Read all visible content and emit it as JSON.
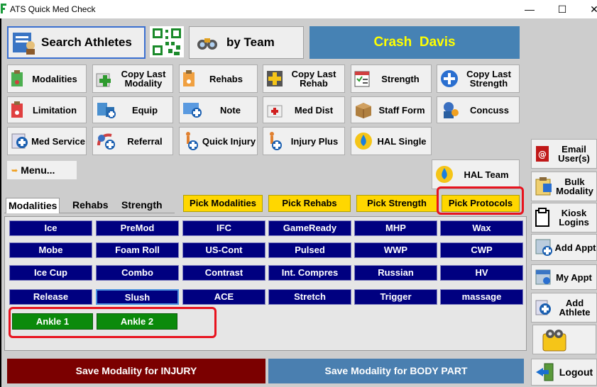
{
  "window": {
    "title": "ATS Quick Med Check",
    "minimize": "—",
    "maximize": "☐",
    "close": "✕"
  },
  "header": {
    "search_athletes": "Search Athletes",
    "by_team": "by Team",
    "athlete_name": "Crash  Davis"
  },
  "quick_buttons": {
    "modalities": "Modalities",
    "copy_last_modality": "Copy Last Modality",
    "rehabs": "Rehabs",
    "copy_last_rehab": "Copy Last Rehab",
    "strength": "Strength",
    "copy_last_strength": "Copy Last Strength",
    "limitation": "Limitation",
    "equip": "Equip",
    "note": "Note",
    "med_dist": "Med Dist",
    "staff_form": "Staff Form",
    "concuss": "Concuss",
    "med_service": "Med Service",
    "referral": "Referral",
    "quick_injury": "Quick Injury",
    "injury_plus": "Injury Plus",
    "hal_single": "HAL Single",
    "hal_team": "HAL Team"
  },
  "menu_label": "Menu...",
  "tabs": [
    "Modalities",
    "Rehabs",
    "Strength"
  ],
  "pick_buttons": [
    "Pick Modalities",
    "Pick Rehabs",
    "Pick Strength",
    "Pick Protocols"
  ],
  "modality_grid": [
    [
      "Ice",
      "PreMod",
      "IFC",
      "GameReady",
      "MHP",
      "Wax"
    ],
    [
      "Mobe",
      "Foam Roll",
      "US-Cont",
      "Pulsed",
      "WWP",
      "CWP"
    ],
    [
      "Ice Cup",
      "Combo",
      "Contrast",
      "Int. Compres",
      "Russian",
      "HV"
    ],
    [
      "Release",
      "Slush",
      "ACE",
      "Stretch",
      "Trigger",
      "massage"
    ]
  ],
  "protocols": [
    "Ankle 1",
    "Ankle 2"
  ],
  "footer": {
    "save_injury": "Save Modality for INJURY",
    "save_body_part": "Save Modality for BODY PART"
  },
  "sidebar": {
    "email_users": "Email User(s)",
    "bulk_modality": "Bulk Modality",
    "kiosk_logins": "Kiosk Logins",
    "add_appt": "Add Appt",
    "my_appt": "My Appt",
    "add_athlete": "Add Athlete",
    "logout": "Logout"
  },
  "colors": {
    "navy": "#000080",
    "green": "#0b8a0b",
    "yellow": "#ffd700",
    "name_bar": "#4682b4",
    "save_injury": "#7b0000",
    "save_body_part": "#4a7fb0",
    "highlight": "#e8131e"
  }
}
